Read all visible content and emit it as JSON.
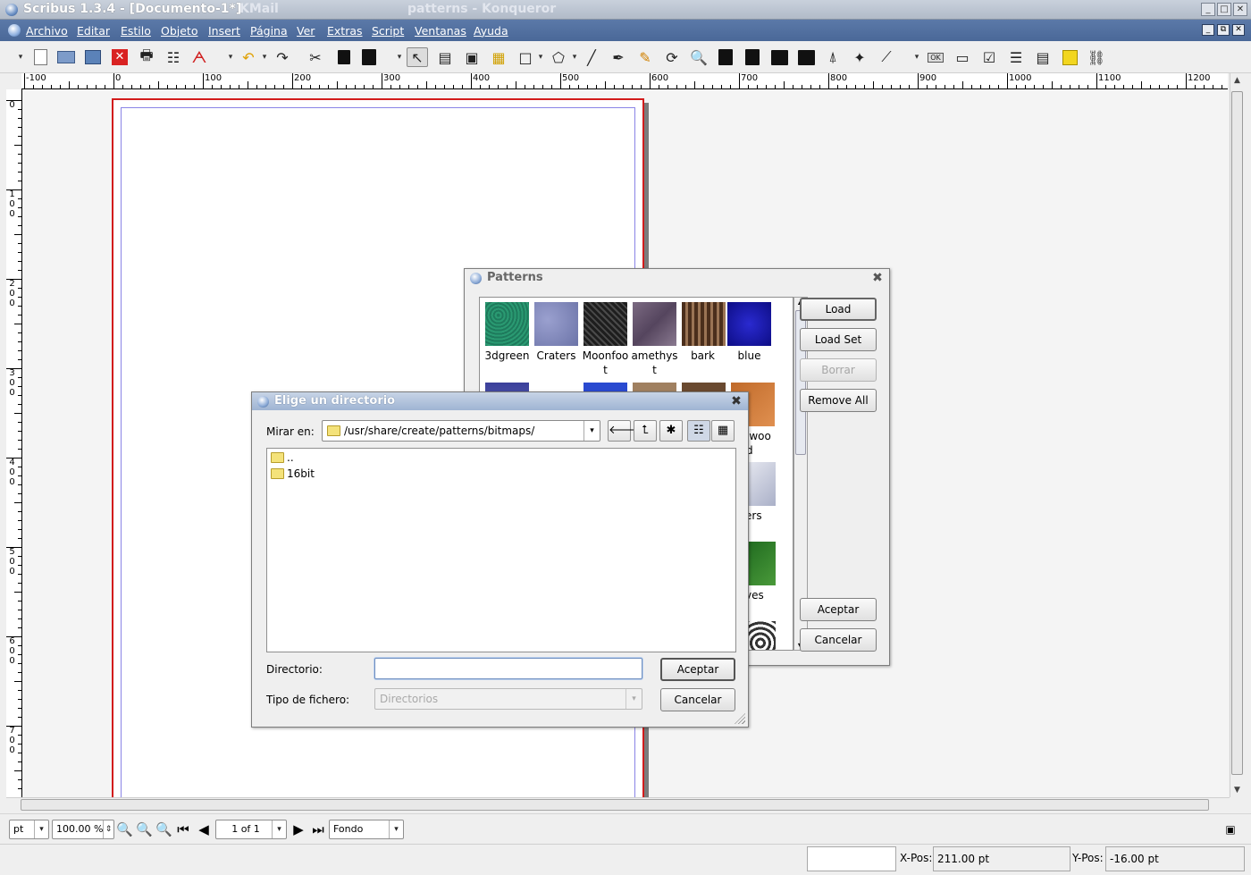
{
  "window": {
    "title": "Scribus 1.3.4 - [Documento-1*]",
    "ghost_title_1": "KMail",
    "ghost_title_2": "patterns - Konqueror"
  },
  "menubar": {
    "items": [
      "Archivo",
      "Editar",
      "Estilo",
      "Objeto",
      "Insert",
      "Página",
      "Ver",
      "Extras",
      "Script",
      "Ventanas",
      "Ayuda"
    ]
  },
  "toolbar": {
    "icons": [
      "new-document-icon",
      "open-icon",
      "save-icon",
      "close-document-icon",
      "print-icon",
      "preflight-icon",
      "export-pdf-icon",
      "undo-icon",
      "redo-icon",
      "cut-icon",
      "copy-icon",
      "paste-icon",
      "select-icon",
      "text-frame-icon",
      "image-frame-icon",
      "table-icon",
      "shape-icon",
      "polygon-icon",
      "line-icon",
      "bezier-icon",
      "freehand-icon",
      "rotate-icon",
      "zoom-icon",
      "edit-contents-icon",
      "link-frames-icon",
      "unlink-frames-icon",
      "measure-icon",
      "copy-properties-icon",
      "eyedropper-icon",
      "pdf-button-icon",
      "pdf-textfield-icon",
      "pdf-checkbox-icon",
      "pdf-combobox-icon",
      "pdf-listbox-icon",
      "pdf-annotation-icon",
      "pdf-link-icon"
    ],
    "ok_label": "OK"
  },
  "rulers": {
    "horizontal": [
      "-100",
      "0",
      "100",
      "200",
      "300",
      "400",
      "500",
      "600",
      "700",
      "800",
      "900",
      "1000",
      "1100",
      "1200"
    ],
    "vertical": [
      "0",
      "100",
      "200",
      "300",
      "400",
      "500",
      "600",
      "700"
    ]
  },
  "bottombar": {
    "unit": "pt",
    "zoom": "100.00 %",
    "page": "1 of 1",
    "layer": "Fondo"
  },
  "statusbar": {
    "xpos_label": "X-Pos:",
    "xpos_value": "211.00 pt",
    "ypos_label": "Y-Pos:",
    "ypos_value": "-16.00 pt"
  },
  "patterns_dialog": {
    "title": "Patterns",
    "patterns": [
      {
        "name": "3dgreen",
        "color": "#1e7a5c"
      },
      {
        "name": "Craters",
        "color": "#7b83b5"
      },
      {
        "name": "Moonfoot",
        "color": "#2a2a2a"
      },
      {
        "name": "amethyst",
        "color": "#6d5a72"
      },
      {
        "name": "bark",
        "color": "#6b4a30"
      },
      {
        "name": "blue",
        "color": "#1a1ab0"
      }
    ],
    "partial_labels": [
      "lwoo",
      "d",
      "ers",
      "ves"
    ],
    "buttons": {
      "load": "Load",
      "load_set": "Load Set",
      "borrar": "Borrar",
      "remove_all": "Remove All",
      "aceptar": "Aceptar",
      "cancelar": "Cancelar"
    }
  },
  "dir_dialog": {
    "title": "Elige un directorio",
    "look_in_label": "Mirar en:",
    "path": "/usr/share/create/patterns/bitmaps/",
    "entries": [
      "..",
      "16bit"
    ],
    "directory_label": "Directorio:",
    "directory_value": "",
    "filetype_label": "Tipo de fichero:",
    "filetype_value": "Directorios",
    "accept": "Aceptar",
    "cancel": "Cancelar"
  }
}
